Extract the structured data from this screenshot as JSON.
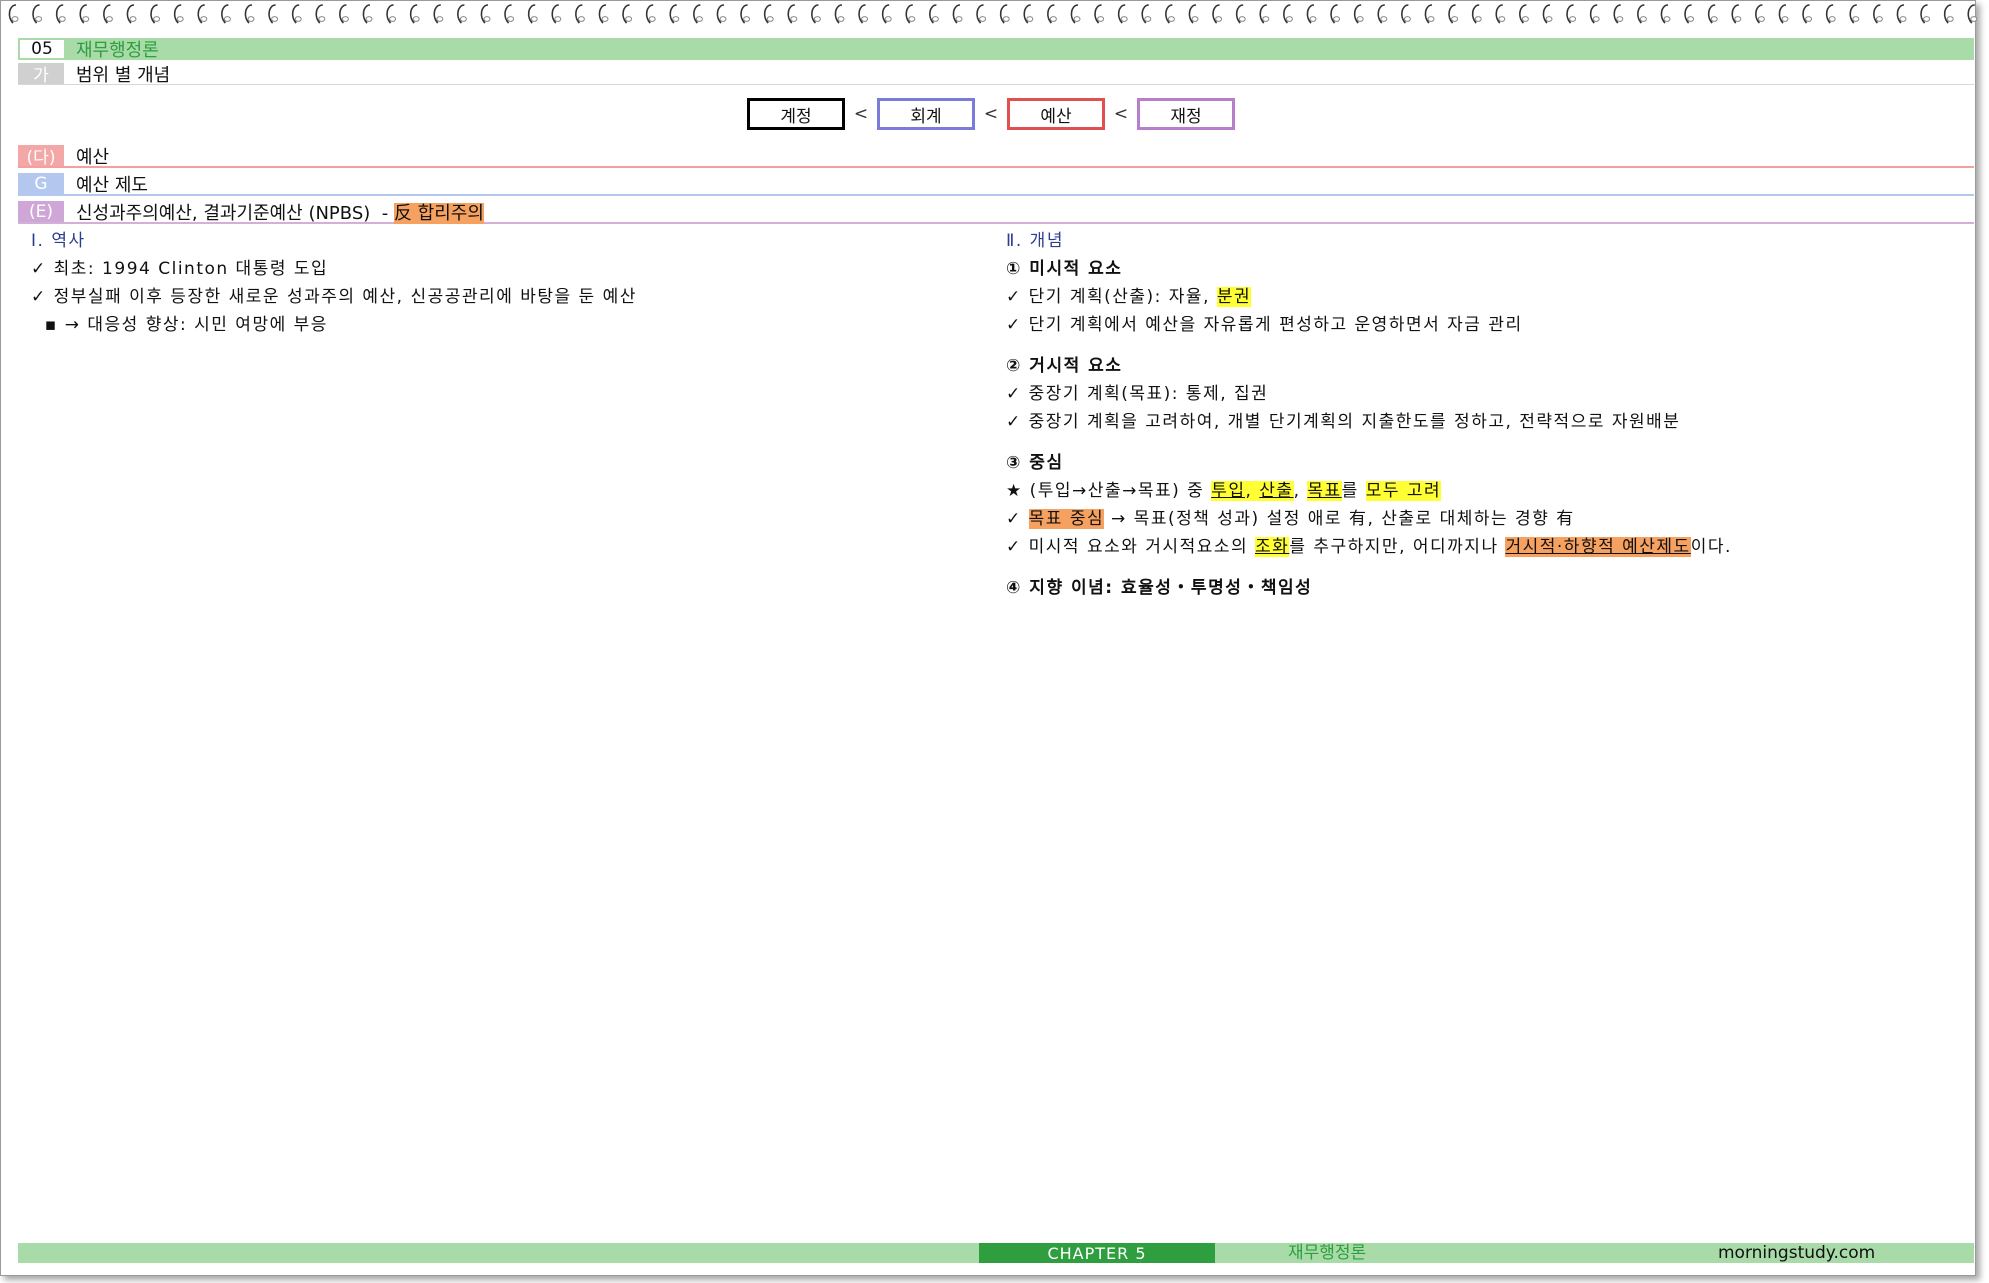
{
  "header": {
    "chapter_num": "05",
    "chapter_title": "재무행정론",
    "section_tag": "가",
    "section_title": "범위 별 개념"
  },
  "flow": {
    "items": [
      "계정",
      "회계",
      "예산",
      "재정"
    ],
    "separator": "<",
    "colors": [
      "#000000",
      "#7b7bdc",
      "#e05050",
      "#b77fc9"
    ]
  },
  "subsections": {
    "da": {
      "tag": "(다)",
      "title": "예산"
    },
    "g": {
      "tag": "G",
      "title": "예산 제도"
    },
    "e": {
      "tag": "(E)",
      "title": "신성과주의예산, 결과기준예산 (NPBS)  - ",
      "highlight": "反 합리주의"
    }
  },
  "left": {
    "heading": "Ⅰ. 역사",
    "lines": [
      "✓ 최초: 1994 Clinton 대통령 도입",
      "✓ 정부실패 이후 등장한 새로운 성과주의 예산, 신공공관리에 바탕을 둔 예산",
      "  ▪ → 대응성 향상: 시민 여망에 부응"
    ]
  },
  "right": {
    "heading": "Ⅱ. 개념",
    "micro": {
      "title": "① 미시적 요소",
      "l1_pre": "✓ 단기 계획(산출): 자율, ",
      "l1_hl": "분권",
      "l2": "✓ 단기 계획에서 예산을 자유롭게 편성하고 운영하면서 자금 관리"
    },
    "macro": {
      "title": "② 거시적 요소",
      "l1": "✓ 중장기 계획(목표): 통제, 집권",
      "l2": "✓ 중장기 계획을 고려하여, 개별 단기계획의 지출한도를 정하고, 전략적으로 자원배분"
    },
    "center": {
      "title": "③ 중심",
      "s1_pre": "★ (투입→산출→목표) 중 ",
      "s1_h1": "투입",
      "s1_c1": ", ",
      "s1_h2": "산출",
      "s1_c2": ", ",
      "s1_h3": "목표",
      "s1_mid": "를 ",
      "s1_h4": "모두 고려",
      "s2_hl": "목표 중심",
      "s2_rest": " → 목표(정책 성과) 설정 애로 有, 산출로 대체하는 경향 有",
      "s2_check": "✓ ",
      "s3_pre": "✓ 미시적 요소와 거시적요소의 ",
      "s3_hl": "조화",
      "s3_mid": "를 추구하지만, 어디까지나 ",
      "s3_hl2": "거시적·하향적 예산제도",
      "s3_end": "이다."
    },
    "ideology": "④ 지향 이념: 효율성・투명성・책임성"
  },
  "footer": {
    "chapter": "CHAPTER 5",
    "title": "재무행정론",
    "site": "morningstudy.com"
  }
}
